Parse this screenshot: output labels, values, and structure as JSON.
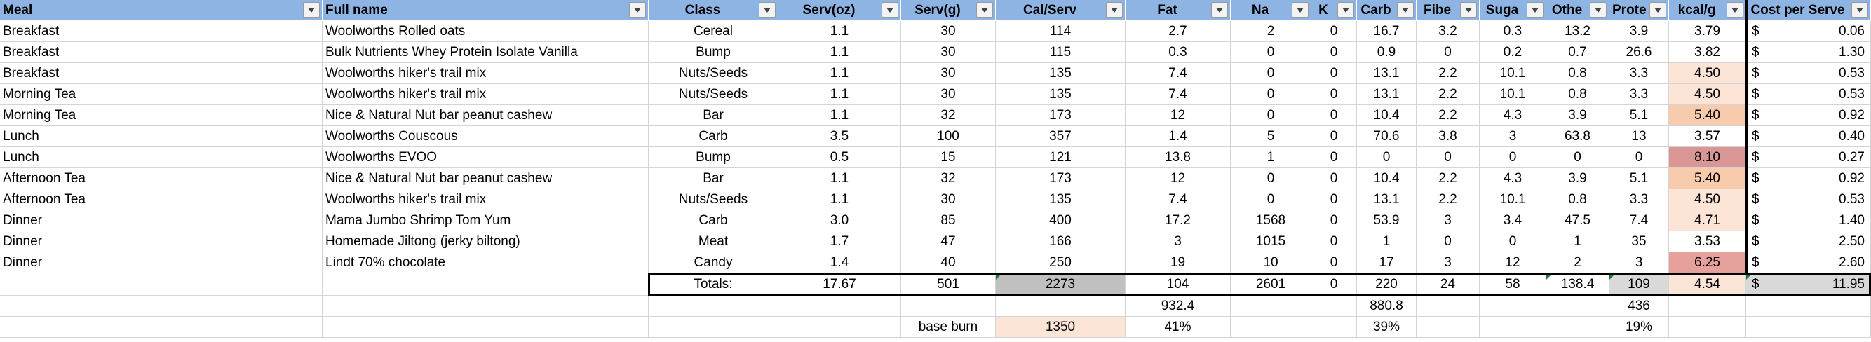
{
  "sheet": {
    "headers": [
      "Meal",
      "Full name",
      "Class",
      "Serv(oz)",
      "Serv(g)",
      "Cal/Serv",
      "Fat",
      "Na",
      "K",
      "Carb",
      "Fibe",
      "Suga",
      "Othe",
      "Prote",
      "kcal/g",
      "Cost per Serve"
    ],
    "rows": [
      [
        "Breakfast",
        "Woolworths Rolled oats",
        "Cereal",
        "1.1",
        "30",
        "114",
        "2.7",
        "2",
        "0",
        "16.7",
        "3.2",
        "0.3",
        "13.2",
        "3.9",
        "3.79",
        "0.06"
      ],
      [
        "Breakfast",
        "Bulk Nutrients Whey Protein Isolate Vanilla",
        "Bump",
        "1.1",
        "30",
        "115",
        "0.3",
        "0",
        "0",
        "0.9",
        "0",
        "0.2",
        "0.7",
        "26.6",
        "3.82",
        "1.30"
      ],
      [
        "Breakfast",
        "Woolworths hiker's trail mix",
        "Nuts/Seeds",
        "1.1",
        "30",
        "135",
        "7.4",
        "0",
        "0",
        "13.1",
        "2.2",
        "10.1",
        "0.8",
        "3.3",
        "4.50",
        "0.53"
      ],
      [
        "Morning Tea",
        "Woolworths hiker's trail mix",
        "Nuts/Seeds",
        "1.1",
        "30",
        "135",
        "7.4",
        "0",
        "0",
        "13.1",
        "2.2",
        "10.1",
        "0.8",
        "3.3",
        "4.50",
        "0.53"
      ],
      [
        "Morning Tea",
        "Nice & Natural Nut bar peanut cashew",
        "Bar",
        "1.1",
        "32",
        "173",
        "12",
        "0",
        "0",
        "10.4",
        "2.2",
        "4.3",
        "3.9",
        "5.1",
        "5.40",
        "0.92"
      ],
      [
        "Lunch",
        "Woolworths Couscous",
        "Carb",
        "3.5",
        "100",
        "357",
        "1.4",
        "5",
        "0",
        "70.6",
        "3.8",
        "3",
        "63.8",
        "13",
        "3.57",
        "0.40"
      ],
      [
        "Lunch",
        "Woolworths EVOO",
        "Bump",
        "0.5",
        "15",
        "121",
        "13.8",
        "1",
        "0",
        "0",
        "0",
        "0",
        "0",
        "0",
        "8.10",
        "0.27"
      ],
      [
        "Afternoon Tea",
        "Nice & Natural Nut bar peanut cashew",
        "Bar",
        "1.1",
        "32",
        "173",
        "12",
        "0",
        "0",
        "10.4",
        "2.2",
        "4.3",
        "3.9",
        "5.1",
        "5.40",
        "0.92"
      ],
      [
        "Afternoon Tea",
        "Woolworths hiker's trail mix",
        "Nuts/Seeds",
        "1.1",
        "30",
        "135",
        "7.4",
        "0",
        "0",
        "13.1",
        "2.2",
        "10.1",
        "0.8",
        "3.3",
        "4.50",
        "0.53"
      ],
      [
        "Dinner",
        "Mama  Jumbo Shrimp Tom Yum",
        "Carb",
        "3.0",
        "85",
        "400",
        "17.2",
        "1568",
        "0",
        "53.9",
        "3",
        "3.4",
        "47.5",
        "7.4",
        "4.71",
        "1.40"
      ],
      [
        "Dinner",
        "Homemade Jiltong (jerky biltong)",
        "Meat",
        "1.7",
        "47",
        "166",
        "3",
        "1015",
        "0",
        "1",
        "0",
        "0",
        "1",
        "35",
        "3.53",
        "2.50"
      ],
      [
        "Dinner",
        "Lindt 70% chocolate",
        "Candy",
        "1.4",
        "40",
        "250",
        "19",
        "10",
        "0",
        "17",
        "3",
        "12",
        "2",
        "3",
        "6.25",
        "2.60"
      ]
    ],
    "kcal_colors": [
      "#ffffff",
      "#ffffff",
      "#fce4d6",
      "#fce4d6",
      "#f8cbad",
      "#ffffff",
      "#da9694",
      "#f8cbad",
      "#fce4d6",
      "#fce4d6",
      "#ffffff",
      "#e6a19c"
    ],
    "currency_symbol": "$",
    "totals": {
      "label": "Totals:",
      "serv_oz": "17.67",
      "serv_g": "501",
      "cal": "2273",
      "fat": "104",
      "na": "2601",
      "k": "0",
      "carb": "220",
      "fibre": "24",
      "sugar": "58",
      "other": "138.4",
      "protein": "109",
      "kcal_g": "4.54",
      "cost": "11.95"
    },
    "extra_row_1": {
      "fat": "932.4",
      "carb": "880.8",
      "protein": "436"
    },
    "extra_row_2": {
      "label": "base burn",
      "value": "1350",
      "fat_pct": "41%",
      "carb_pct": "39%",
      "protein_pct": "19%"
    },
    "colors": {
      "header": "#8eb4e3",
      "totals_grey": "#c0c0c0",
      "peach_light": "#fce4d6",
      "peach": "#f8cbad",
      "rose": "#da9694",
      "error_triangle": "#1e7b34"
    }
  }
}
